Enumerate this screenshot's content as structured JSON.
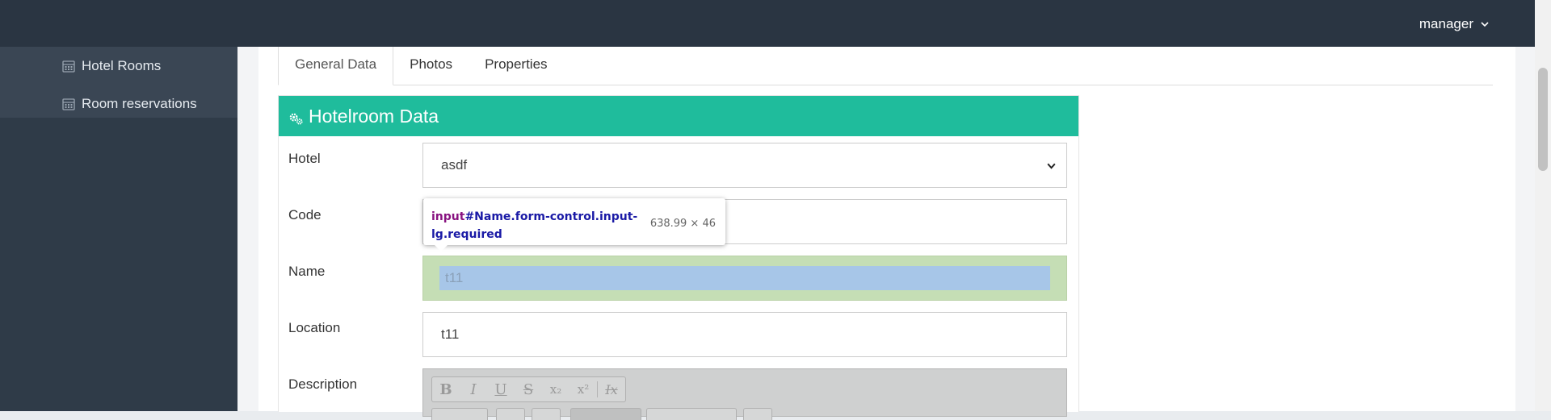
{
  "header": {
    "user": "manager"
  },
  "sidebar": {
    "items": [
      {
        "label": "Hotel Rooms",
        "icon": "calendar-icon"
      },
      {
        "label": "Room reservations",
        "icon": "calendar-icon"
      }
    ]
  },
  "tabs": [
    {
      "label": "General Data",
      "active": true
    },
    {
      "label": "Photos",
      "active": false
    },
    {
      "label": "Properties",
      "active": false
    }
  ],
  "box": {
    "title": "Hotelroom Data",
    "icon": "cogs-icon",
    "accent": "#1fbc9c"
  },
  "form": {
    "hotel": {
      "label": "Hotel",
      "value": "asdf"
    },
    "code": {
      "label": "Code",
      "value": ""
    },
    "name": {
      "label": "Name",
      "value": "t11"
    },
    "location": {
      "label": "Location",
      "value": "t11"
    },
    "description": {
      "label": "Description"
    }
  },
  "editor": {
    "buttons": [
      "B",
      "I",
      "U",
      "S",
      "x₂",
      "x²",
      "Ix"
    ]
  },
  "tooltip": {
    "tag": "input",
    "selector": "#Name.form-control.input-lg.required",
    "size": "638.99 × 46"
  }
}
